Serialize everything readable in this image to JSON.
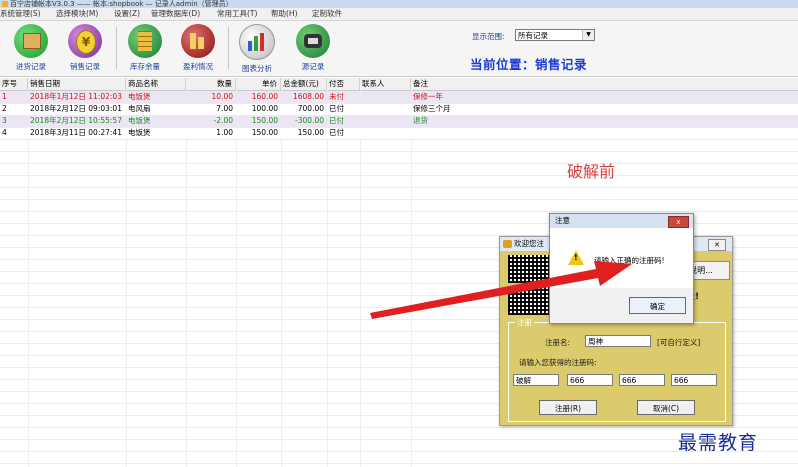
{
  "window": {
    "title": "百宁店铺帐本V3.0.3 —— 帐本:shopbook — 记录人admin（管理员）"
  },
  "menu": [
    "系统管理(S)",
    "选择模块(M)",
    "设置(Z)",
    "管理数据库(D)",
    "常用工具(T)",
    "帮助(H)",
    "定制软件"
  ],
  "toolbar": {
    "buttons": [
      {
        "label": "进货记录",
        "icon": "box-icon"
      },
      {
        "label": "销售记录",
        "icon": "money-icon"
      },
      {
        "label": "库存余量",
        "icon": "stack-icon"
      },
      {
        "label": "盈利情况",
        "icon": "profit-icon"
      },
      {
        "label": "图表分析",
        "icon": "chart-icon"
      },
      {
        "label": "源记录",
        "icon": "phone-icon"
      }
    ],
    "range_label": "显示范围:",
    "range_value": "所有记录",
    "location": "当前位置：销售记录"
  },
  "table": {
    "headers": [
      "序号",
      "销售日期",
      "商品名称",
      "数量",
      "单价",
      "总金额(元)",
      "付否",
      "联系人",
      "备注"
    ],
    "rows": [
      {
        "no": "1",
        "date": "2018年1月12日 11:02:03",
        "item": "电饭煲",
        "qty": "10.00",
        "price": "160.00",
        "total": "1608.00",
        "paid": "未付",
        "contact": "",
        "note": "保修一年",
        "color": "#d01010"
      },
      {
        "no": "2",
        "date": "2018年2月12日 09:03:01",
        "item": "电风扇",
        "qty": "7.00",
        "price": "100.00",
        "total": "700.00",
        "paid": "已付",
        "contact": "",
        "note": "保修三个月",
        "color": "#000000"
      },
      {
        "no": "3",
        "date": "2018年2月12日 10:55:57",
        "item": "电饭煲",
        "qty": "-2.00",
        "price": "150.00",
        "total": "-300.00",
        "paid": "已付",
        "contact": "",
        "note": "退货",
        "color": "#1a8a1a"
      },
      {
        "no": "4",
        "date": "2018年3月11日 00:27:41",
        "item": "电饭煲",
        "qty": "1.00",
        "price": "150.00",
        "total": "150.00",
        "paid": "已付",
        "contact": "",
        "note": "",
        "color": "#000000"
      }
    ]
  },
  "annotation": "破解前",
  "register_dialog": {
    "title": "欢迎您注",
    "how_button": "说明...",
    "exclaim": "级!",
    "group_label": "注册",
    "name_label": "注册名:",
    "name_value": "周神",
    "name_hint": "[可自行定义]",
    "code_label": "请输入您获得的注册码:",
    "code_values": [
      "破解",
      "666",
      "666",
      "666"
    ],
    "register_button": "注册(R)",
    "cancel_button": "取消(C)"
  },
  "message_box": {
    "title": "注意",
    "text": "请输入正确的注册码!",
    "ok": "确定",
    "close": "x"
  },
  "brand": "最需教育"
}
